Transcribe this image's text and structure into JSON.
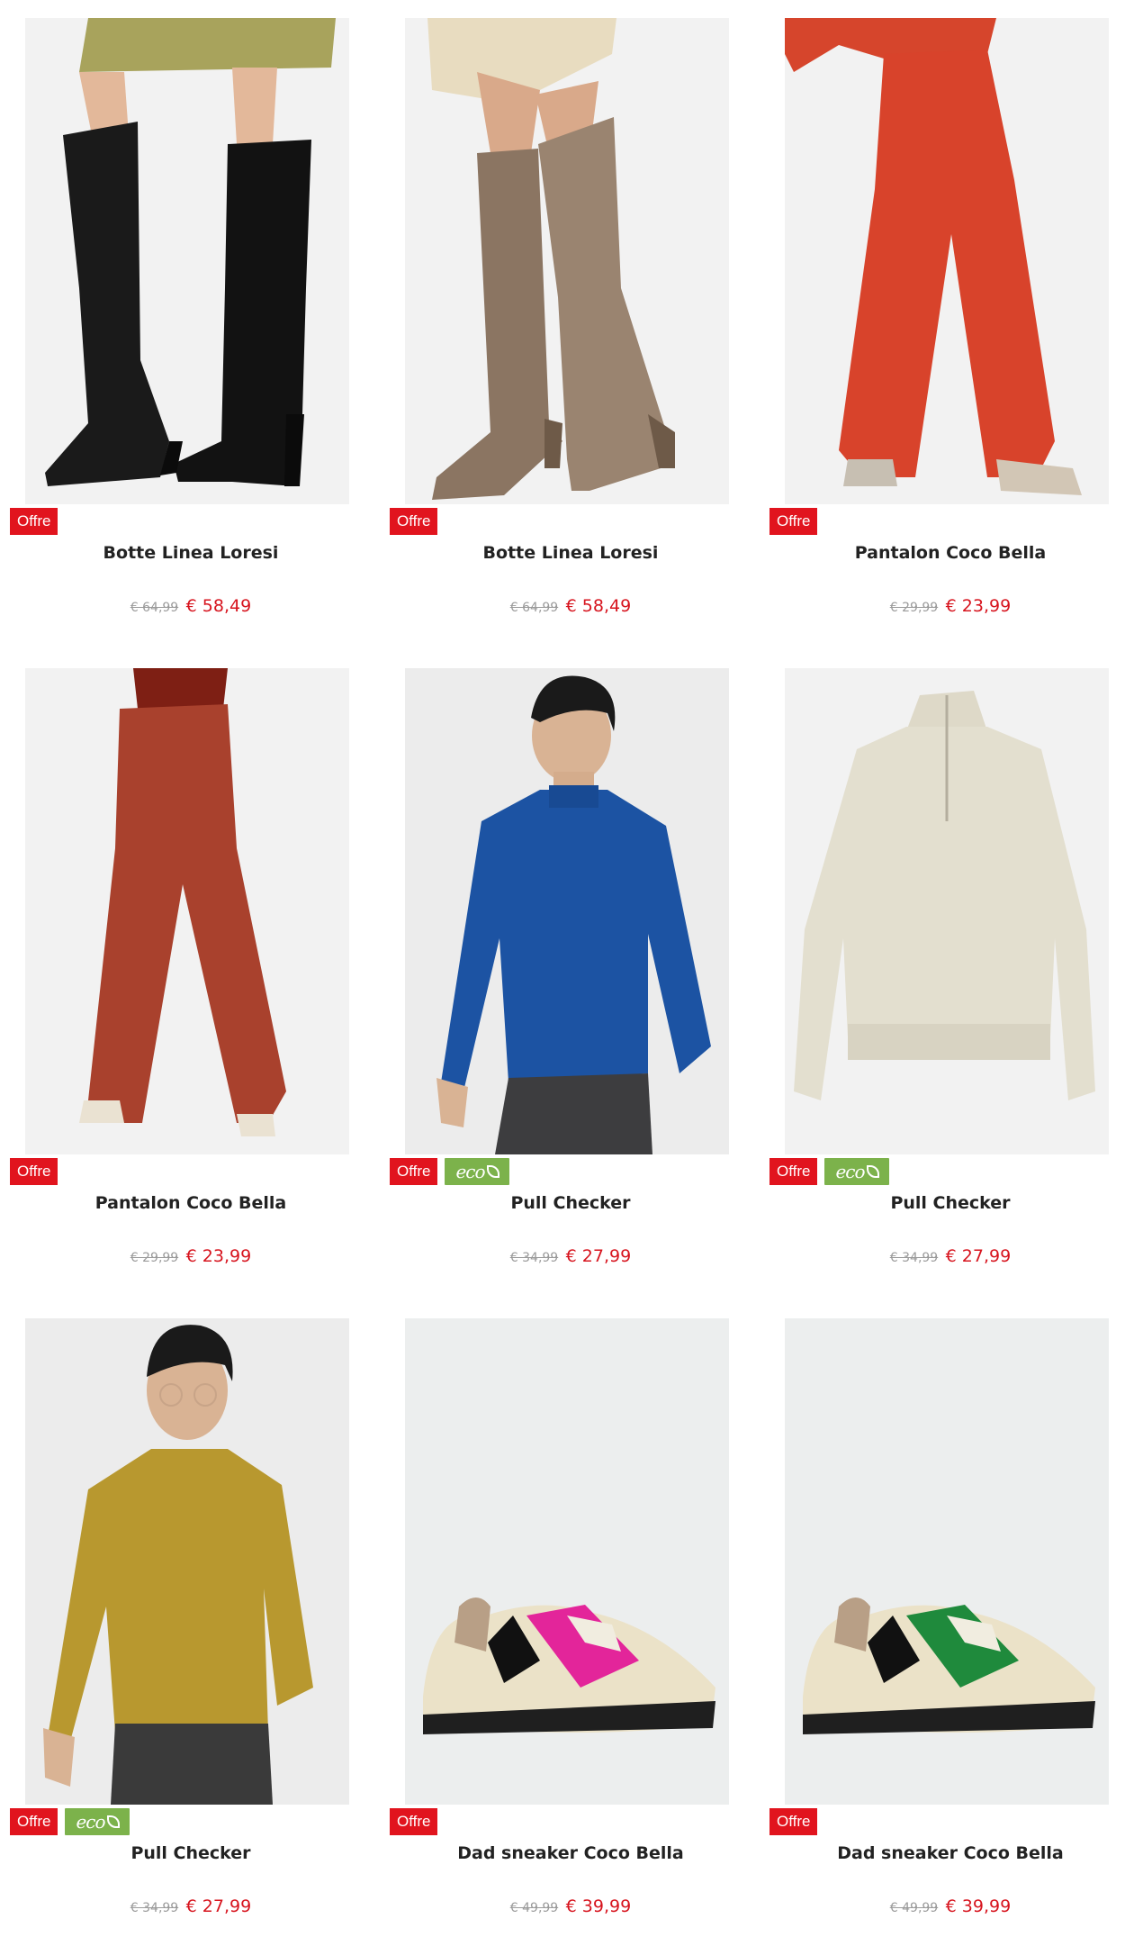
{
  "colors": {
    "offre_badge": "#e1141e",
    "eco_badge": "#7cb24b",
    "price": "#d7141e",
    "old_price": "#9a9a9a"
  },
  "products": [
    {
      "name": "Botte Linea Loresi",
      "old_price": "€ 64,99",
      "price": "€ 58,49",
      "badge": "Offre",
      "eco": null,
      "image": "black-knee-boots"
    },
    {
      "name": "Botte Linea Loresi",
      "old_price": "€ 64,99",
      "price": "€ 58,49",
      "badge": "Offre",
      "eco": null,
      "image": "taupe-suede-knee-boots"
    },
    {
      "name": "Pantalon Coco Bella",
      "old_price": "€ 29,99",
      "price": "€ 23,99",
      "badge": "Offre",
      "eco": null,
      "image": "red-wide-trousers"
    },
    {
      "name": "Pantalon Coco Bella",
      "old_price": "€ 29,99",
      "price": "€ 23,99",
      "badge": "Offre",
      "eco": null,
      "image": "rust-wide-trousers"
    },
    {
      "name": "Pull Checker",
      "old_price": "€ 34,99",
      "price": "€ 27,99",
      "badge": "Offre",
      "eco": "eco",
      "image": "blue-zip-sweater-model"
    },
    {
      "name": "Pull Checker",
      "old_price": "€ 34,99",
      "price": "€ 27,99",
      "badge": "Offre",
      "eco": "eco",
      "image": "beige-zip-sweater"
    },
    {
      "name": "Pull Checker",
      "old_price": "€ 34,99",
      "price": "€ 27,99",
      "badge": "Offre",
      "eco": "eco",
      "image": "mustard-zip-sweater-model"
    },
    {
      "name": "Dad sneaker Coco Bella",
      "old_price": "€ 49,99",
      "price": "€ 39,99",
      "badge": "Offre",
      "eco": null,
      "image": "pink-dad-sneaker"
    },
    {
      "name": "Dad sneaker Coco Bella",
      "old_price": "€ 49,99",
      "price": "€ 39,99",
      "badge": "Offre",
      "eco": null,
      "image": "green-dad-sneaker"
    }
  ]
}
